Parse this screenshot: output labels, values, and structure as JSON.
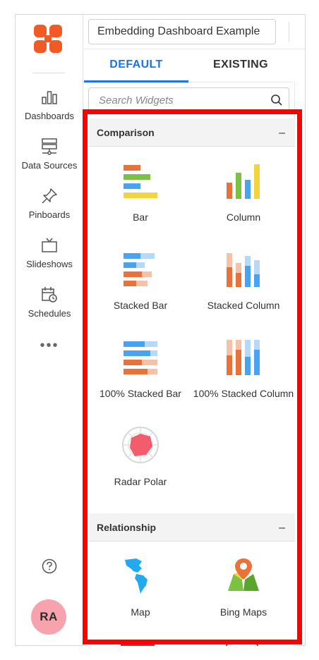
{
  "header": {
    "dashboard_name": "Embedding Dashboard Example"
  },
  "nav": {
    "items": [
      {
        "label": "Dashboards",
        "icon": "bar-chart-icon"
      },
      {
        "label": "Data Sources",
        "icon": "server-icon"
      },
      {
        "label": "Pinboards",
        "icon": "pin-icon"
      },
      {
        "label": "Slideshows",
        "icon": "tv-icon"
      },
      {
        "label": "Schedules",
        "icon": "calendar-clock-icon"
      }
    ],
    "more": "•••",
    "avatar_initials": "RA"
  },
  "tabs": {
    "default_label": "DEFAULT",
    "existing_label": "EXISTING"
  },
  "search": {
    "placeholder": "Search Widgets"
  },
  "sections": {
    "comparison": {
      "title": "Comparison",
      "collapse": "–",
      "widgets": [
        {
          "label": "Bar"
        },
        {
          "label": "Column"
        },
        {
          "label": "Stacked Bar"
        },
        {
          "label": "Stacked Column"
        },
        {
          "label": "100% Stacked Bar"
        },
        {
          "label": "100% Stacked Column"
        },
        {
          "label": "Radar Polar"
        }
      ]
    },
    "relationship": {
      "title": "Relationship",
      "collapse": "–",
      "widgets": [
        {
          "label": "Map"
        },
        {
          "label": "Bing Maps"
        }
      ]
    }
  },
  "colors": {
    "brand": "#f15a24",
    "accent": "#1a73e8",
    "highlight": "#ff0000",
    "avatar": "#f7a3ae"
  }
}
